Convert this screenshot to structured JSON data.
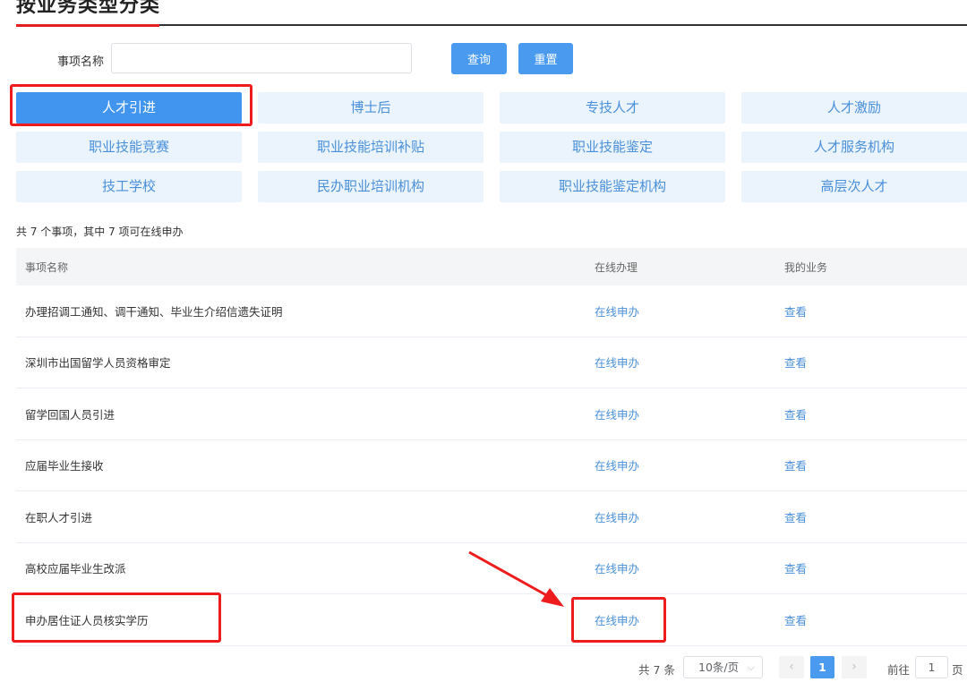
{
  "page": {
    "title": "按业务类型分类"
  },
  "search": {
    "label": "事项名称",
    "value": "",
    "placeholder": "",
    "query_label": "查询",
    "reset_label": "重置"
  },
  "categories": [
    {
      "label": "人才引进",
      "active": true
    },
    {
      "label": "博士后",
      "active": false
    },
    {
      "label": "专技人才",
      "active": false
    },
    {
      "label": "人才激励",
      "active": false
    },
    {
      "label": "职业技能竞赛",
      "active": false
    },
    {
      "label": "职业技能培训补贴",
      "active": false
    },
    {
      "label": "职业技能鉴定",
      "active": false
    },
    {
      "label": "人才服务机构",
      "active": false
    },
    {
      "label": "技工学校",
      "active": false
    },
    {
      "label": "民办职业培训机构",
      "active": false
    },
    {
      "label": "职业技能鉴定机构",
      "active": false
    },
    {
      "label": "高层次人才",
      "active": false
    }
  ],
  "summary": "共 7 个事项，其中 7 项可在线申办",
  "table": {
    "headers": [
      "事项名称",
      "在线办理",
      "我的业务"
    ],
    "rows": [
      {
        "name": "办理招调工通知、调干通知、毕业生介绍信遗失证明",
        "online": "在线申办",
        "mine": "查看"
      },
      {
        "name": "深圳市出国留学人员资格审定",
        "online": "在线申办",
        "mine": "查看"
      },
      {
        "name": "留学回国人员引进",
        "online": "在线申办",
        "mine": "查看"
      },
      {
        "name": "应届毕业生接收",
        "online": "在线申办",
        "mine": "查看"
      },
      {
        "name": "在职人才引进",
        "online": "在线申办",
        "mine": "查看"
      },
      {
        "name": "高校应届毕业生改派",
        "online": "在线申办",
        "mine": "查看"
      },
      {
        "name": "申办居住证人员核实学历",
        "online": "在线申办",
        "mine": "查看"
      }
    ]
  },
  "pagination": {
    "total": "共 7 条",
    "page_size": "10条/页",
    "prev_icon": "‹",
    "next_icon": "›",
    "current_page": "1",
    "goto_label": "前往",
    "goto_value": "1",
    "page_unit": "页"
  },
  "icons": {
    "page_size_dropdown": "chevron-down-icon",
    "prev": "chevron-left-icon",
    "next": "chevron-right-icon"
  },
  "colors": {
    "primary": "#4a9bef",
    "active_category": "#4195ef",
    "category_bg": "#ebf4fc",
    "category_text": "#4a8fd9",
    "link": "#4a8fd9",
    "annotation_red": "#ee1c1c"
  }
}
